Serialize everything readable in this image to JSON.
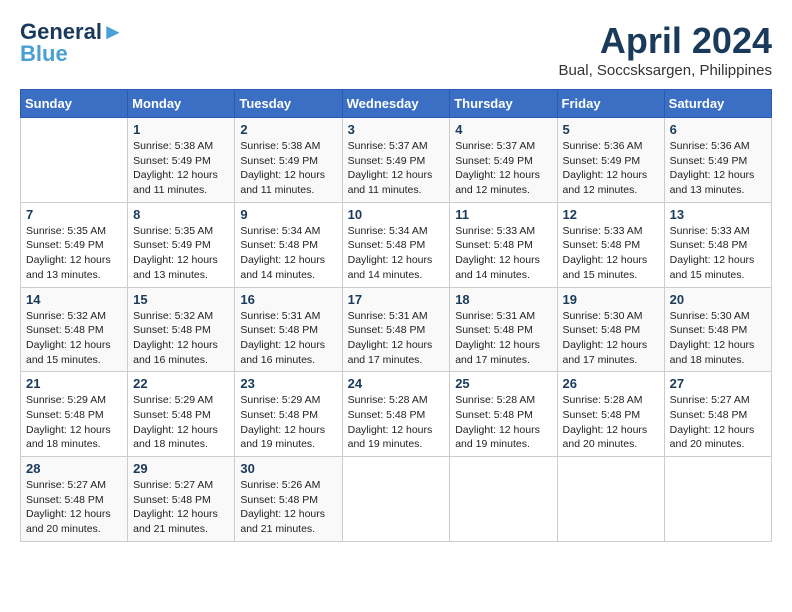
{
  "header": {
    "logo_line1": "General",
    "logo_line2": "Blue",
    "month_title": "April 2024",
    "location": "Bual, Soccsksargen, Philippines"
  },
  "weekdays": [
    "Sunday",
    "Monday",
    "Tuesday",
    "Wednesday",
    "Thursday",
    "Friday",
    "Saturday"
  ],
  "weeks": [
    [
      {
        "day": "",
        "detail": ""
      },
      {
        "day": "1",
        "detail": "Sunrise: 5:38 AM\nSunset: 5:49 PM\nDaylight: 12 hours\nand 11 minutes."
      },
      {
        "day": "2",
        "detail": "Sunrise: 5:38 AM\nSunset: 5:49 PM\nDaylight: 12 hours\nand 11 minutes."
      },
      {
        "day": "3",
        "detail": "Sunrise: 5:37 AM\nSunset: 5:49 PM\nDaylight: 12 hours\nand 11 minutes."
      },
      {
        "day": "4",
        "detail": "Sunrise: 5:37 AM\nSunset: 5:49 PM\nDaylight: 12 hours\nand 12 minutes."
      },
      {
        "day": "5",
        "detail": "Sunrise: 5:36 AM\nSunset: 5:49 PM\nDaylight: 12 hours\nand 12 minutes."
      },
      {
        "day": "6",
        "detail": "Sunrise: 5:36 AM\nSunset: 5:49 PM\nDaylight: 12 hours\nand 13 minutes."
      }
    ],
    [
      {
        "day": "7",
        "detail": "Sunrise: 5:35 AM\nSunset: 5:49 PM\nDaylight: 12 hours\nand 13 minutes."
      },
      {
        "day": "8",
        "detail": "Sunrise: 5:35 AM\nSunset: 5:49 PM\nDaylight: 12 hours\nand 13 minutes."
      },
      {
        "day": "9",
        "detail": "Sunrise: 5:34 AM\nSunset: 5:48 PM\nDaylight: 12 hours\nand 14 minutes."
      },
      {
        "day": "10",
        "detail": "Sunrise: 5:34 AM\nSunset: 5:48 PM\nDaylight: 12 hours\nand 14 minutes."
      },
      {
        "day": "11",
        "detail": "Sunrise: 5:33 AM\nSunset: 5:48 PM\nDaylight: 12 hours\nand 14 minutes."
      },
      {
        "day": "12",
        "detail": "Sunrise: 5:33 AM\nSunset: 5:48 PM\nDaylight: 12 hours\nand 15 minutes."
      },
      {
        "day": "13",
        "detail": "Sunrise: 5:33 AM\nSunset: 5:48 PM\nDaylight: 12 hours\nand 15 minutes."
      }
    ],
    [
      {
        "day": "14",
        "detail": "Sunrise: 5:32 AM\nSunset: 5:48 PM\nDaylight: 12 hours\nand 15 minutes."
      },
      {
        "day": "15",
        "detail": "Sunrise: 5:32 AM\nSunset: 5:48 PM\nDaylight: 12 hours\nand 16 minutes."
      },
      {
        "day": "16",
        "detail": "Sunrise: 5:31 AM\nSunset: 5:48 PM\nDaylight: 12 hours\nand 16 minutes."
      },
      {
        "day": "17",
        "detail": "Sunrise: 5:31 AM\nSunset: 5:48 PM\nDaylight: 12 hours\nand 17 minutes."
      },
      {
        "day": "18",
        "detail": "Sunrise: 5:31 AM\nSunset: 5:48 PM\nDaylight: 12 hours\nand 17 minutes."
      },
      {
        "day": "19",
        "detail": "Sunrise: 5:30 AM\nSunset: 5:48 PM\nDaylight: 12 hours\nand 17 minutes."
      },
      {
        "day": "20",
        "detail": "Sunrise: 5:30 AM\nSunset: 5:48 PM\nDaylight: 12 hours\nand 18 minutes."
      }
    ],
    [
      {
        "day": "21",
        "detail": "Sunrise: 5:29 AM\nSunset: 5:48 PM\nDaylight: 12 hours\nand 18 minutes."
      },
      {
        "day": "22",
        "detail": "Sunrise: 5:29 AM\nSunset: 5:48 PM\nDaylight: 12 hours\nand 18 minutes."
      },
      {
        "day": "23",
        "detail": "Sunrise: 5:29 AM\nSunset: 5:48 PM\nDaylight: 12 hours\nand 19 minutes."
      },
      {
        "day": "24",
        "detail": "Sunrise: 5:28 AM\nSunset: 5:48 PM\nDaylight: 12 hours\nand 19 minutes."
      },
      {
        "day": "25",
        "detail": "Sunrise: 5:28 AM\nSunset: 5:48 PM\nDaylight: 12 hours\nand 19 minutes."
      },
      {
        "day": "26",
        "detail": "Sunrise: 5:28 AM\nSunset: 5:48 PM\nDaylight: 12 hours\nand 20 minutes."
      },
      {
        "day": "27",
        "detail": "Sunrise: 5:27 AM\nSunset: 5:48 PM\nDaylight: 12 hours\nand 20 minutes."
      }
    ],
    [
      {
        "day": "28",
        "detail": "Sunrise: 5:27 AM\nSunset: 5:48 PM\nDaylight: 12 hours\nand 20 minutes."
      },
      {
        "day": "29",
        "detail": "Sunrise: 5:27 AM\nSunset: 5:48 PM\nDaylight: 12 hours\nand 21 minutes."
      },
      {
        "day": "30",
        "detail": "Sunrise: 5:26 AM\nSunset: 5:48 PM\nDaylight: 12 hours\nand 21 minutes."
      },
      {
        "day": "",
        "detail": ""
      },
      {
        "day": "",
        "detail": ""
      },
      {
        "day": "",
        "detail": ""
      },
      {
        "day": "",
        "detail": ""
      }
    ]
  ]
}
